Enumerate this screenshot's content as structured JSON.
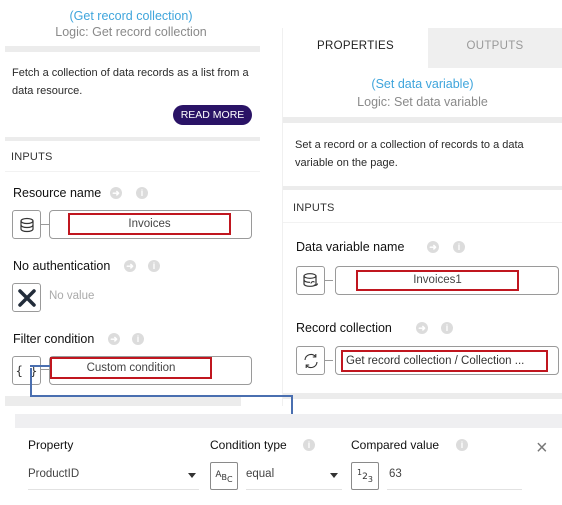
{
  "left_panel": {
    "title": "(Get record collection)",
    "subtitle": "Logic: Get record collection",
    "description": "Fetch a collection of data records as a list from a data resource.",
    "read_more_label": "READ MORE",
    "inputs_label": "INPUTS",
    "fields": {
      "resource_name": {
        "label": "Resource name",
        "value": "Invoices",
        "icon": "database-icon"
      },
      "no_authentication": {
        "label": "No authentication",
        "value": "No value",
        "icon": "x-icon"
      },
      "filter_condition": {
        "label": "Filter condition",
        "value": "Custom condition",
        "icon": "braces-icon"
      }
    }
  },
  "right_panel": {
    "tabs": [
      {
        "label": "PROPERTIES",
        "active": true
      },
      {
        "label": "OUTPUTS",
        "active": false
      }
    ],
    "title": "(Set data variable)",
    "subtitle": "Logic: Set data variable",
    "description": "Set a record or a collection of records to a data variable on the page.",
    "inputs_label": "INPUTS",
    "fields": {
      "data_variable_name": {
        "label": "Data variable name",
        "value": "Invoices1",
        "icon": "data-variable-icon"
      },
      "record_collection": {
        "label": "Record collection",
        "value": "Get record collection / Collection ...",
        "icon": "refresh-icon"
      }
    }
  },
  "condition_panel": {
    "property": {
      "header": "Property",
      "value": "ProductID"
    },
    "condition_type": {
      "header": "Condition type",
      "value": "equal",
      "type_icon": "ABC"
    },
    "compared_value": {
      "header": "Compared value",
      "value": "63",
      "type_icon": "123"
    },
    "close_label": "×"
  },
  "colors": {
    "link": "#3fa5dc",
    "button_bg": "#2a1366",
    "highlight_red": "#c0161f",
    "connector_blue": "#4a6fb0"
  }
}
